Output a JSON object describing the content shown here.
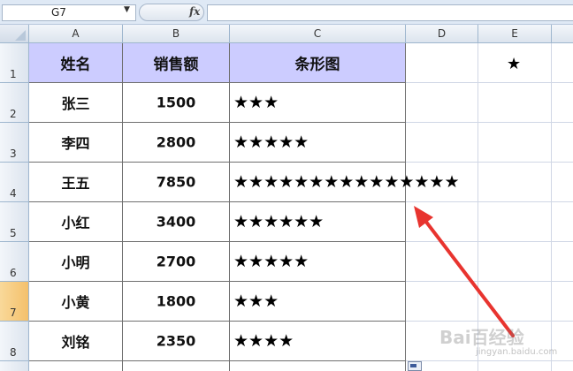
{
  "name_box": {
    "value": "G7"
  },
  "formula_bar": {
    "fx_label": "fx",
    "value": ""
  },
  "columns": [
    "A",
    "B",
    "C",
    "D",
    "E"
  ],
  "rows": [
    "1",
    "2",
    "3",
    "4",
    "5",
    "6",
    "7",
    "8"
  ],
  "selected_row": "7",
  "table": {
    "headers": [
      "姓名",
      "销售额",
      "条形图"
    ],
    "records": [
      {
        "name": "张三",
        "sales": "1500",
        "bar": "★★★"
      },
      {
        "name": "李四",
        "sales": "2800",
        "bar": "★★★★★"
      },
      {
        "name": "王五",
        "sales": "7850",
        "bar": "★★★★★★★★★★★★★★★"
      },
      {
        "name": "小红",
        "sales": "3400",
        "bar": "★★★★★★"
      },
      {
        "name": "小明",
        "sales": "2700",
        "bar": "★★★★★"
      },
      {
        "name": "小黄",
        "sales": "1800",
        "bar": "★★★"
      },
      {
        "name": "刘铭",
        "sales": "2350",
        "bar": "★★★★"
      }
    ]
  },
  "e1_value": "★",
  "watermark": {
    "brand": "Bai百经验",
    "url": "jingyan.baidu.com"
  },
  "colors": {
    "header_fill": "#ccccff",
    "selected_row_header": "#f4c06b",
    "annotation_arrow": "#e8342f"
  }
}
